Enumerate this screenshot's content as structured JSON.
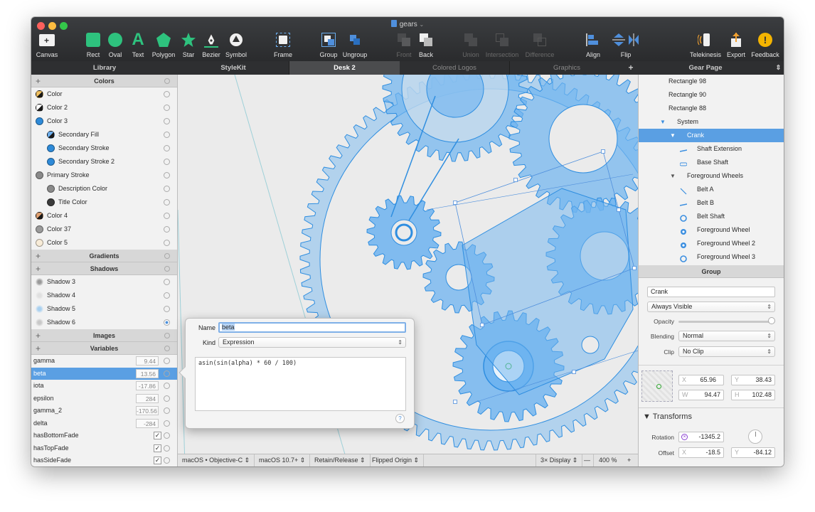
{
  "window": {
    "title": "gears"
  },
  "toolbar": [
    {
      "label": "Canvas",
      "icon": "canvas-icon",
      "enabled": true
    },
    {
      "label": "Rect",
      "icon": "rect-icon",
      "enabled": true
    },
    {
      "label": "Oval",
      "icon": "oval-icon",
      "enabled": true
    },
    {
      "label": "Text",
      "icon": "text-icon",
      "enabled": true
    },
    {
      "label": "Polygon",
      "icon": "polygon-icon",
      "enabled": true
    },
    {
      "label": "Star",
      "icon": "star-icon",
      "enabled": true
    },
    {
      "label": "Bezier",
      "icon": "bezier-icon",
      "enabled": true
    },
    {
      "label": "Symbol",
      "icon": "symbol-icon",
      "enabled": true
    },
    {
      "label": "Frame",
      "icon": "frame-icon",
      "enabled": true
    },
    {
      "label": "Group",
      "icon": "group-icon",
      "enabled": true
    },
    {
      "label": "Ungroup",
      "icon": "ungroup-icon",
      "enabled": true
    },
    {
      "label": "Front",
      "icon": "front-icon",
      "enabled": false
    },
    {
      "label": "Back",
      "icon": "back-icon",
      "enabled": true
    },
    {
      "label": "Union",
      "icon": "union-icon",
      "enabled": false
    },
    {
      "label": "Intersection",
      "icon": "intersection-icon",
      "enabled": false
    },
    {
      "label": "Difference",
      "icon": "difference-icon",
      "enabled": false
    },
    {
      "label": "Align",
      "icon": "align-icon",
      "enabled": true
    },
    {
      "label": "Flip",
      "icon": "flip-icon",
      "enabled": true
    },
    {
      "label": "Telekinesis",
      "icon": "telekinesis-icon",
      "enabled": true
    },
    {
      "label": "Export",
      "icon": "export-icon",
      "enabled": true
    },
    {
      "label": "Feedback",
      "icon": "feedback-icon",
      "enabled": true
    }
  ],
  "tabs": {
    "library": "Library",
    "stylekit": "StyleKit",
    "desk": "Desk 2",
    "colored_logos": "Colored Logos",
    "graphics": "Graphics",
    "add": "+",
    "page": "Gear Page",
    "page_arrows": "⇕"
  },
  "library": {
    "colors_header": "Colors",
    "colors": [
      {
        "name": "Color",
        "color": "#1a1a1a",
        "half": "#f0c060",
        "indent": 0
      },
      {
        "name": "Color 2",
        "color": "#1a1a1a",
        "half": "#ffffff",
        "indent": 0
      },
      {
        "name": "Color 3",
        "color": "#2e8ad8",
        "half": "",
        "indent": 0
      },
      {
        "name": "Secondary Fill",
        "color": "#1a1a1a",
        "half": "#6fb0ef",
        "indent": 1
      },
      {
        "name": "Secondary Stroke",
        "color": "#2e8ad8",
        "half": "",
        "indent": 1
      },
      {
        "name": "Secondary Stroke 2",
        "color": "#2e8ad8",
        "half": "",
        "indent": 1
      },
      {
        "name": "Primary Stroke",
        "color": "#8a8a8a",
        "half": "",
        "indent": 0
      },
      {
        "name": "Description Color",
        "color": "#8a8a8a",
        "half": "",
        "indent": 1
      },
      {
        "name": "Title Color",
        "color": "#3a3a3a",
        "half": "",
        "indent": 1
      },
      {
        "name": "Color 4",
        "color": "#1a1a1a",
        "half": "#e0a070",
        "indent": 0
      },
      {
        "name": "Color 37",
        "color": "#9a9a9a",
        "half": "",
        "indent": 0
      },
      {
        "name": "Color 5",
        "color": "#f8ecd8",
        "half": "",
        "indent": 0
      }
    ],
    "gradients_header": "Gradients",
    "shadows_header": "Shadows",
    "shadows": [
      {
        "name": "Shadow 3",
        "color": "#9a9a9a"
      },
      {
        "name": "Shadow 4",
        "color": "#e0e0e0"
      },
      {
        "name": "Shadow 5",
        "color": "#a8d0f0"
      },
      {
        "name": "Shadow 6",
        "color": "#c8c8c8"
      }
    ],
    "images_header": "Images",
    "variables_header": "Variables",
    "variables": [
      {
        "name": "gamma",
        "value": "9.44",
        "type": "number"
      },
      {
        "name": "beta",
        "value": "13.56",
        "type": "number"
      },
      {
        "name": "iota",
        "value": "-17.86",
        "type": "number"
      },
      {
        "name": "epsilon",
        "value": "284",
        "type": "number"
      },
      {
        "name": "gamma_2",
        "value": "-170.56",
        "type": "number"
      },
      {
        "name": "delta",
        "value": "-284",
        "type": "number"
      },
      {
        "name": "hasBottomFade",
        "value": "✓",
        "type": "bool"
      },
      {
        "name": "hasTopFade",
        "value": "✓",
        "type": "bool"
      },
      {
        "name": "hasSideFade",
        "value": "✓",
        "type": "bool"
      }
    ]
  },
  "popover": {
    "name_label": "Name",
    "name_value": "beta",
    "kind_label": "Kind",
    "kind_value": "Expression",
    "expression": "asin(sin(alpha) * 60 / 100)",
    "help": "?"
  },
  "bottom": {
    "language": "macOS • Objective-C",
    "target": "macOS 10.7+",
    "memory": "Retain/Release",
    "origin": "Flipped Origin",
    "display": "3× Display",
    "zoom_out": "—",
    "zoom": "400 %",
    "zoom_in": "+"
  },
  "tree": [
    {
      "name": "Rectangle 98",
      "indent": 0,
      "icon": "none"
    },
    {
      "name": "Rectangle 90",
      "indent": 0,
      "icon": "none"
    },
    {
      "name": "Rectangle 88",
      "indent": 0,
      "icon": "none"
    },
    {
      "name": "System",
      "indent": 0,
      "icon": "disclosure"
    },
    {
      "name": "Crank",
      "indent": 1,
      "icon": "disclosure"
    },
    {
      "name": "Shaft Extension",
      "indent": 2,
      "icon": "line"
    },
    {
      "name": "Base Shaft",
      "indent": 2,
      "icon": "shaft"
    },
    {
      "name": "Foreground Wheels",
      "indent": 1,
      "icon": "disclosure"
    },
    {
      "name": "Belt A",
      "indent": 2,
      "icon": "diag"
    },
    {
      "name": "Belt B",
      "indent": 2,
      "icon": "line"
    },
    {
      "name": "Belt Shaft",
      "indent": 2,
      "icon": "ring"
    },
    {
      "name": "Foreground Wheel",
      "indent": 2,
      "icon": "gear"
    },
    {
      "name": "Foreground Wheel 2",
      "indent": 2,
      "icon": "gear2"
    },
    {
      "name": "Foreground Wheel 3",
      "indent": 2,
      "icon": "ring2"
    }
  ],
  "inspector": {
    "header": "Group",
    "name": "Crank",
    "visibility": "Always Visible",
    "opacity_label": "Opacity",
    "blending_label": "Blending",
    "blending": "Normal",
    "clip_label": "Clip",
    "clip": "No Clip",
    "x_label": "X",
    "x": "65.96",
    "y_label": "Y",
    "y": "38.43",
    "w_label": "W",
    "w": "94.47",
    "h_label": "H",
    "h": "102.48",
    "transforms_header": "Transforms",
    "rotation_label": "Rotation",
    "rotation": "-1345.2",
    "offset_label": "Offset",
    "offset_x_label": "X",
    "offset_x": "-18.5",
    "offset_y_label": "Y",
    "offset_y": "-84.12"
  },
  "colors": {
    "accent": "#5a9fe3",
    "gear": "#6db3f0",
    "gear_stroke": "#2f8ee0",
    "toolbar_green": "#2ec27e"
  }
}
